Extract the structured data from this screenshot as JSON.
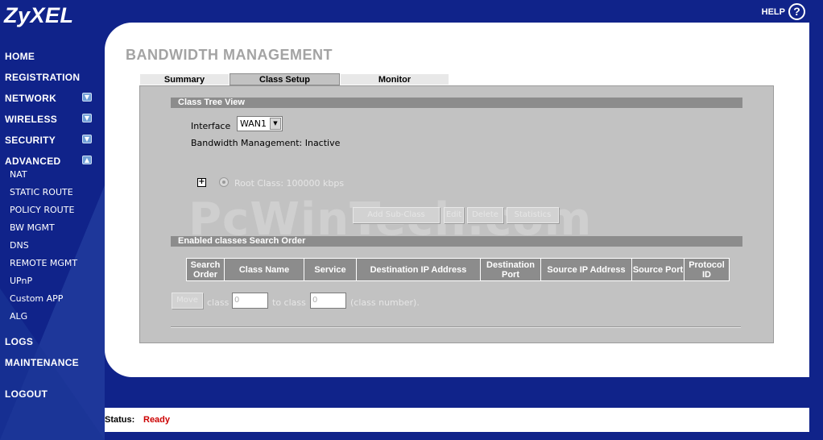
{
  "brand": {
    "logo": "ZyXEL"
  },
  "help": {
    "label": "HELP",
    "icon": "?"
  },
  "sidebar": {
    "main_items": [
      {
        "label": "HOME"
      },
      {
        "label": "REGISTRATION"
      },
      {
        "label": "NETWORK",
        "toggle": "expand"
      },
      {
        "label": "WIRELESS",
        "toggle": "expand"
      },
      {
        "label": "SECURITY",
        "toggle": "expand"
      },
      {
        "label": "ADVANCED",
        "toggle": "collapse"
      },
      {
        "label": "LOGS"
      },
      {
        "label": "MAINTENANCE"
      },
      {
        "label": "LOGOUT"
      }
    ],
    "advanced_items": [
      {
        "label": "NAT"
      },
      {
        "label": "STATIC ROUTE"
      },
      {
        "label": "POLICY ROUTE"
      },
      {
        "label": "BW MGMT"
      },
      {
        "label": "DNS"
      },
      {
        "label": "REMOTE MGMT"
      },
      {
        "label": "UPnP"
      },
      {
        "label": "Custom APP"
      },
      {
        "label": "ALG"
      }
    ]
  },
  "page": {
    "title": "BANDWIDTH MANAGEMENT",
    "tabs": [
      {
        "label": "Summary",
        "active": false
      },
      {
        "label": "Class Setup",
        "active": true
      },
      {
        "label": "Monitor",
        "active": false
      }
    ]
  },
  "class_tree": {
    "section_title": "Class Tree View",
    "interface_label": "Interface",
    "interface_value": "WAN1",
    "bw_status": "Bandwidth Management: Inactive",
    "root_class": "Root Class: 100000 kbps",
    "buttons": {
      "add_subclass": "Add Sub-Class",
      "edit": "Edit",
      "delete": "Delete",
      "statistics": "Statistics"
    }
  },
  "search_order": {
    "section_title": "Enabled classes Search Order",
    "columns": [
      "Search Order",
      "Class Name",
      "Service",
      "Destination IP Address",
      "Destination Port",
      "Source IP Address",
      "Source Port",
      "Protocol ID"
    ],
    "move_label": "Move",
    "class_text": "class",
    "from_value": "0",
    "to_class_text": "to class",
    "to_value": "0",
    "class_number_text": "(class number)."
  },
  "watermark": "PcWinTech.com",
  "status": {
    "label": "Status:",
    "value": "Ready"
  },
  "colors": {
    "navy": "#10238a",
    "panel_gray": "#c2c2c2",
    "section_bar": "#8c8c8c",
    "status_ready": "#cc0000"
  }
}
